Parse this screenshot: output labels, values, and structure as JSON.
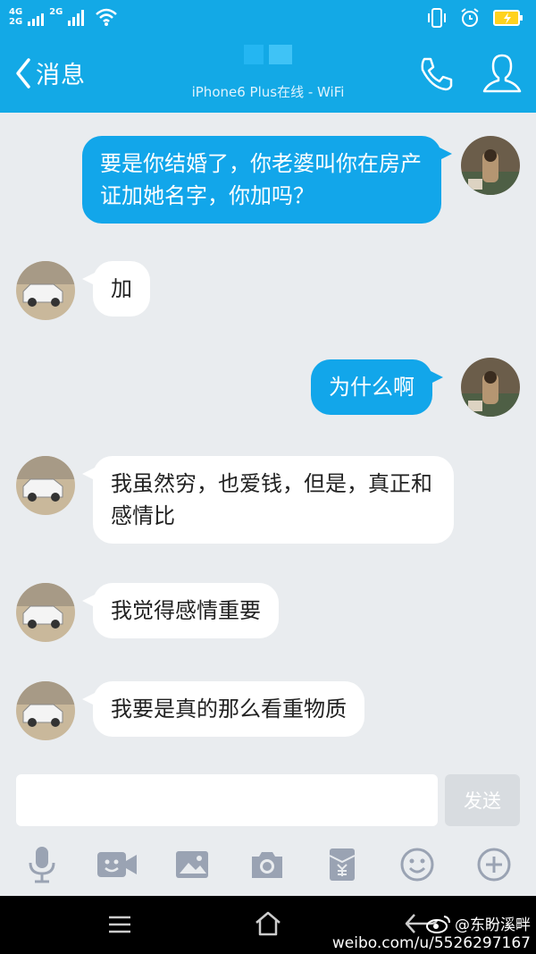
{
  "status_bar": {
    "network_top": "4G",
    "network_bottom": "2G",
    "network_b": "2G"
  },
  "header": {
    "back_label": "消息",
    "subtitle": "iPhone6 Plus在线 - WiFi"
  },
  "messages": [
    {
      "from": "me",
      "text": "要是你结婚了，你老婆叫你在房产证加她名字，你加吗？"
    },
    {
      "from": "them",
      "text": "加"
    },
    {
      "from": "me",
      "text": "为什么啊"
    },
    {
      "from": "them",
      "text": "我虽然穷，也爱钱，但是，真正和感情比"
    },
    {
      "from": "them",
      "text": "我觉得感情重要"
    },
    {
      "from": "them",
      "text": "我要是真的那么看重物质"
    }
  ],
  "composer": {
    "send_label": "发送",
    "placeholder": ""
  },
  "toolbar_icons": [
    "microphone-icon",
    "video-call-icon",
    "image-icon",
    "camera-icon",
    "red-packet-icon",
    "emoji-icon",
    "plus-icon"
  ],
  "watermark": {
    "handle": "@东盼溪畔",
    "url": "weibo.com/u/5526297167"
  },
  "colors": {
    "accent": "#13a9e6",
    "bubble_mine": "#12a6ea",
    "background": "#e9ecef"
  }
}
